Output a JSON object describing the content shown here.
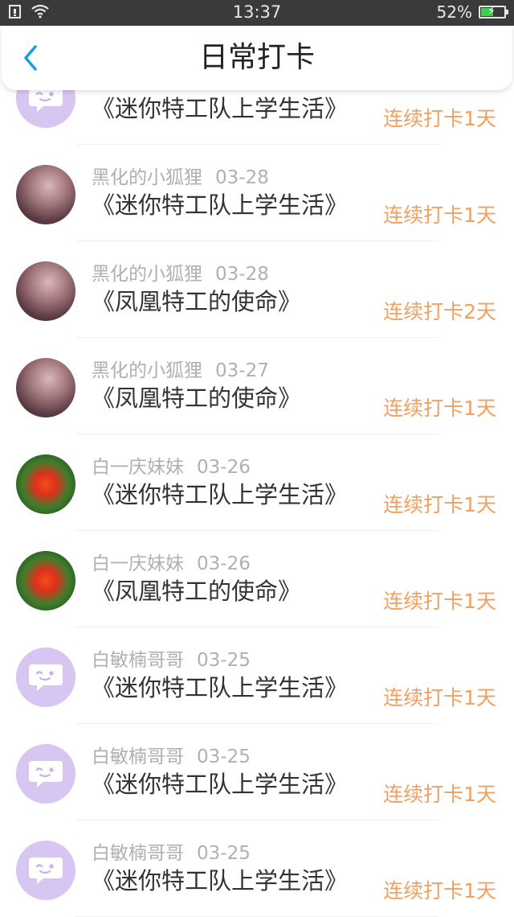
{
  "status_bar": {
    "time": "13:37",
    "battery": "52%",
    "battery_level": 0.52,
    "battery_color": "#38d14a"
  },
  "header": {
    "title": "日常打卡"
  },
  "colors": {
    "streak": "#f0a060",
    "meta": "#b0b0b0",
    "bubble": "#d8c6f2"
  },
  "items": [
    {
      "avatar": "default-bubble-icon",
      "name": "",
      "date": "",
      "course": "《迷你特工队上学生活》",
      "streak": "连续打卡1天"
    },
    {
      "avatar": "anime-girl",
      "name": "黑化的小狐狸",
      "date": "03-28",
      "course": "《迷你特工队上学生活》",
      "streak": "连续打卡1天"
    },
    {
      "avatar": "anime-girl",
      "name": "黑化的小狐狸",
      "date": "03-28",
      "course": "《凤凰特工的使命》",
      "streak": "连续打卡2天"
    },
    {
      "avatar": "anime-girl",
      "name": "黑化的小狐狸",
      "date": "03-27",
      "course": "《凤凰特工的使命》",
      "streak": "连续打卡1天"
    },
    {
      "avatar": "red-flowers",
      "name": "白一庆妹妹",
      "date": "03-26",
      "course": "《迷你特工队上学生活》",
      "streak": "连续打卡1天"
    },
    {
      "avatar": "red-flowers",
      "name": "白一庆妹妹",
      "date": "03-26",
      "course": "《凤凰特工的使命》",
      "streak": "连续打卡1天"
    },
    {
      "avatar": "default-bubble-icon",
      "name": "白敏楠哥哥",
      "date": "03-25",
      "course": "《迷你特工队上学生活》",
      "streak": "连续打卡1天"
    },
    {
      "avatar": "default-bubble-icon",
      "name": "白敏楠哥哥",
      "date": "03-25",
      "course": "《迷你特工队上学生活》",
      "streak": "连续打卡1天"
    },
    {
      "avatar": "default-bubble-icon",
      "name": "白敏楠哥哥",
      "date": "03-25",
      "course": "《迷你特工队上学生活》",
      "streak": "连续打卡1天"
    }
  ]
}
